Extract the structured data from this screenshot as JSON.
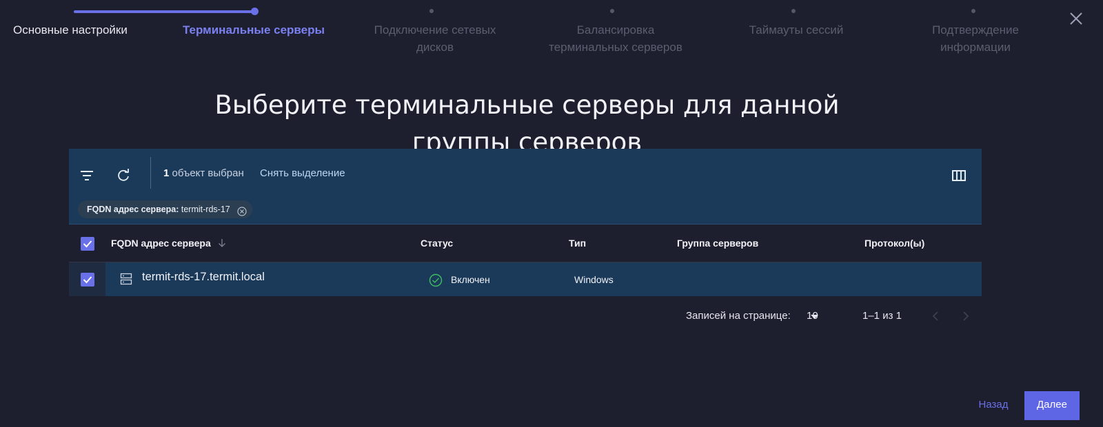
{
  "stepper": {
    "steps": [
      {
        "label": "Основные настройки",
        "state": "done"
      },
      {
        "label": "Терминальные серверы",
        "state": "current"
      },
      {
        "label": "Подключение сетевых\nдисков",
        "state": "pending"
      },
      {
        "label": "Балансировка\nтерминальных серверов",
        "state": "pending"
      },
      {
        "label": "Таймауты сессий",
        "state": "pending"
      },
      {
        "label": "Подтверждение\nинформации",
        "state": "pending"
      }
    ],
    "close_icon": "close-icon",
    "accent": "#6a70e8"
  },
  "title": "Выберите терминальные серверы для данной группы серверов",
  "toolbar": {
    "filter_icon": "filter-icon",
    "refresh_icon": "refresh-icon",
    "selected_count": "1",
    "selected_text": "объект выбран",
    "clear_selection": "Снять выделение",
    "columns_icon": "columns-icon"
  },
  "filter_chip": {
    "key": "FQDN адрес сервера:",
    "value": "termit-rds-17"
  },
  "table": {
    "columns": [
      "FQDN адрес сервера",
      "Статус",
      "Тип",
      "Группа серверов",
      "Протокол(ы)"
    ],
    "sort_icon": "arrow-down-icon",
    "rows": [
      {
        "selected": true,
        "fqdn": "termit-rds-17.termit.local",
        "status": "Включен",
        "type": "Windows",
        "group": "",
        "protocols": ""
      }
    ]
  },
  "pagination": {
    "per_page_label": "Записей на странице:",
    "per_page_value": "10",
    "range": "1–1 из 1"
  },
  "footer": {
    "back": "Назад",
    "next": "Далее"
  }
}
